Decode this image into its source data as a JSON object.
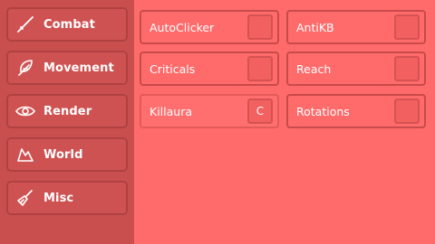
{
  "sidebar": {
    "categories": [
      {
        "label": "Combat",
        "icon": "sword-icon"
      },
      {
        "label": "Movement",
        "icon": "feather-icon"
      },
      {
        "label": "Render",
        "icon": "eye-icon"
      },
      {
        "label": "World",
        "icon": "mountain-icon"
      },
      {
        "label": "Misc",
        "icon": "broom-icon"
      }
    ]
  },
  "modules": [
    {
      "name": "AutoClicker",
      "key": ""
    },
    {
      "name": "AntiKB",
      "key": ""
    },
    {
      "name": "Criticals",
      "key": ""
    },
    {
      "name": "Reach",
      "key": ""
    },
    {
      "name": "Killaura",
      "key": "C"
    },
    {
      "name": "Rotations",
      "key": ""
    }
  ],
  "colors": {
    "sidebar": "#c94f4f",
    "panel": "#ff6b6b",
    "border": "#c94a4a",
    "text": "#ffffff"
  }
}
